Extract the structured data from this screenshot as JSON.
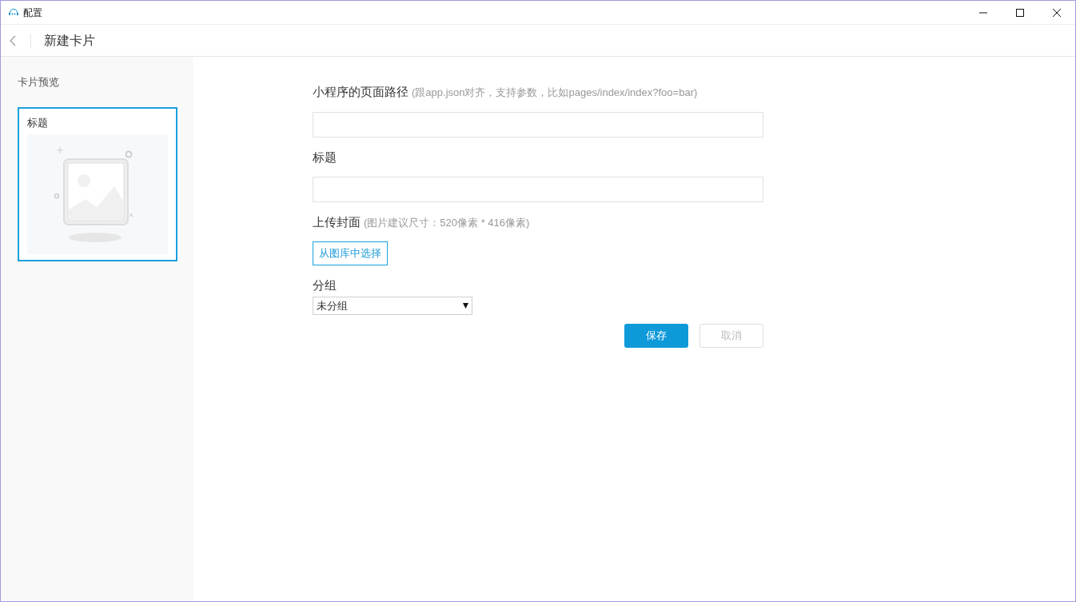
{
  "window": {
    "title": "配置"
  },
  "header": {
    "title": "新建卡片"
  },
  "sidebar": {
    "heading": "卡片预览",
    "card": {
      "title": "标题",
      "selected": true
    }
  },
  "form": {
    "fields": [
      {
        "kind": "text",
        "label": "小程序的页面路径",
        "hint": "(跟app.json对齐，支持参数，比如pages/index/index?foo=bar)"
      },
      {
        "kind": "text",
        "label": "标题"
      },
      {
        "kind": "upload",
        "label": "上传封面",
        "hint": "(图片建议尺寸：520像素 * 416像素)",
        "button": "从图库中选择"
      },
      {
        "kind": "select",
        "label": "分组",
        "value": "未分组"
      }
    ],
    "buttons": [
      {
        "label": "保存",
        "primary": true,
        "disabled": false
      },
      {
        "label": "取消",
        "primary": false,
        "disabled": true
      }
    ]
  }
}
